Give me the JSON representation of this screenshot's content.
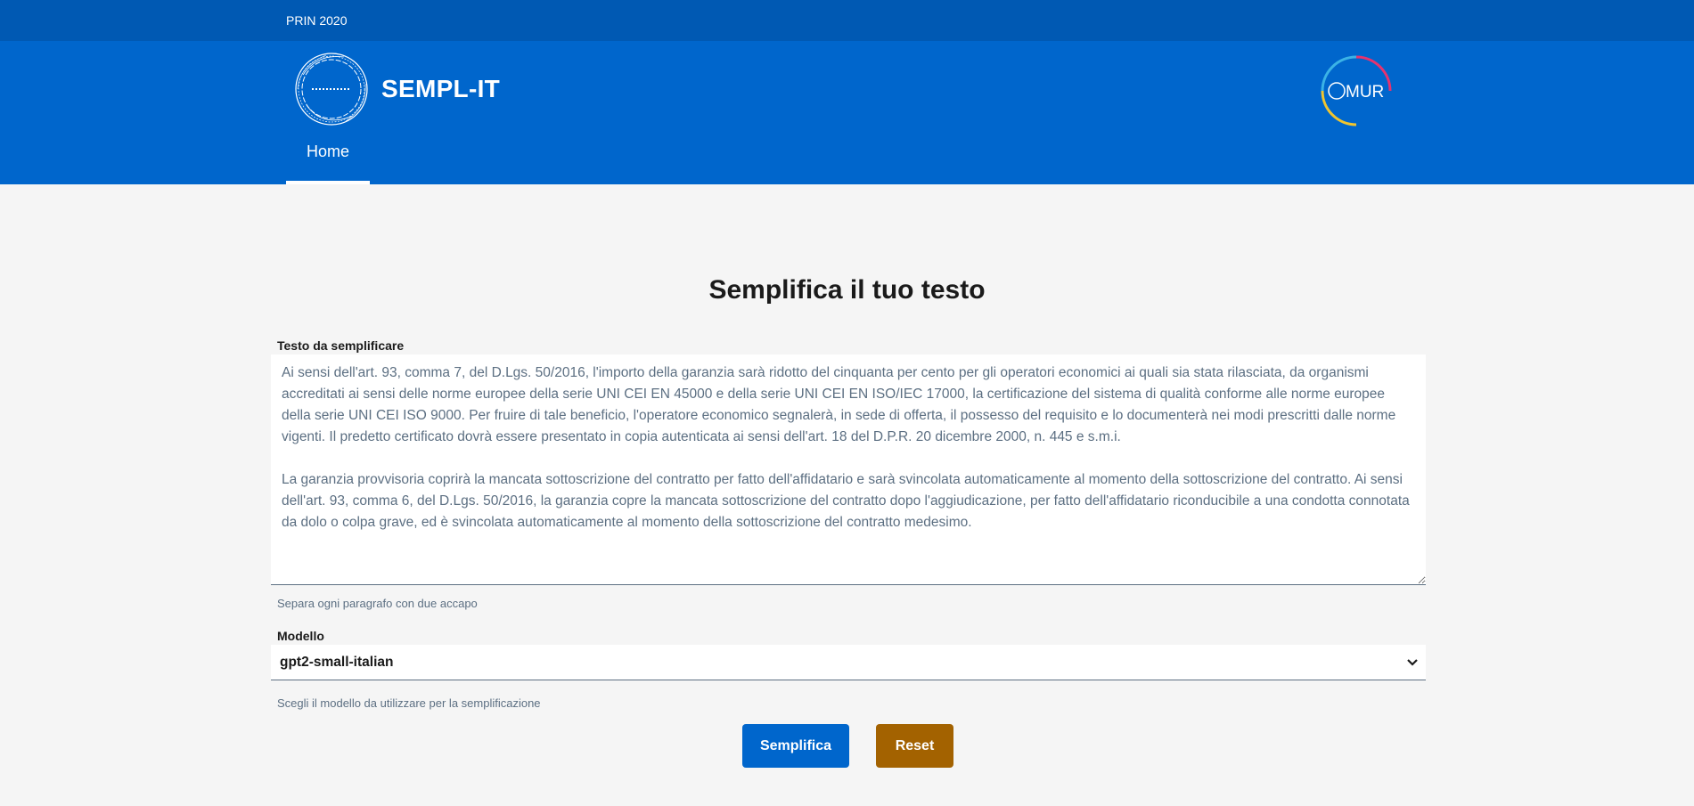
{
  "slim_header": {
    "label": "PRIN 2020"
  },
  "brand": {
    "name": "SEMPL-IT",
    "logo_icon": "sempl-it-circular-logo-icon"
  },
  "partner": {
    "logo_text": "MUR",
    "logo_icon": "mur-logo-icon"
  },
  "nav": {
    "items": [
      {
        "label": "Home",
        "active": true
      }
    ]
  },
  "main": {
    "title": "Semplifica il tuo testo",
    "text_field": {
      "label": "Testo da semplificare",
      "value": "Ai sensi dell'art. 93, comma 7, del D.Lgs. 50/2016, l'importo della garanzia sarà ridotto del cinquanta per cento per gli operatori economici ai quali sia stata rilasciata, da organismi accreditati ai sensi delle norme europee della serie UNI CEI EN 45000 e della serie UNI CEI EN ISO/IEC 17000, la certificazione del sistema di qualità conforme alle norme europee della serie UNI CEI ISO 9000. Per fruire di tale beneficio, l'operatore economico segnalerà, in sede di offerta, il possesso del requisito e lo documenterà nei modi prescritti dalle norme vigenti. Il predetto certificato dovrà essere presentato in copia autenticata ai sensi dell'art. 18 del D.P.R. 20 dicembre 2000, n. 445 e s.m.i.\n\nLa garanzia provvisoria coprirà la mancata sottoscrizione del contratto per fatto dell'affidatario e sarà svincolata automaticamente al momento della sottoscrizione del contratto. Ai sensi dell'art. 93, comma 6, del D.Lgs. 50/2016, la garanzia copre la mancata sottoscrizione del contratto dopo l'aggiudicazione, per fatto dell'affidatario riconducibile a una condotta connotata da dolo o colpa grave, ed è svincolata automaticamente al momento della sottoscrizione del contratto medesimo.",
      "help": "Separa ogni paragrafo con due accapo"
    },
    "model_field": {
      "label": "Modello",
      "selected": "gpt2-small-italian",
      "help": "Scegli il modello da utilizzare per la semplificazione"
    },
    "buttons": {
      "submit": "Semplifica",
      "reset": "Reset"
    }
  },
  "colors": {
    "slim_header_bg": "#0059b3",
    "header_bg": "#0066cc",
    "primary": "#0066cc",
    "secondary": "#a36200",
    "page_bg": "#f5f5f5"
  }
}
